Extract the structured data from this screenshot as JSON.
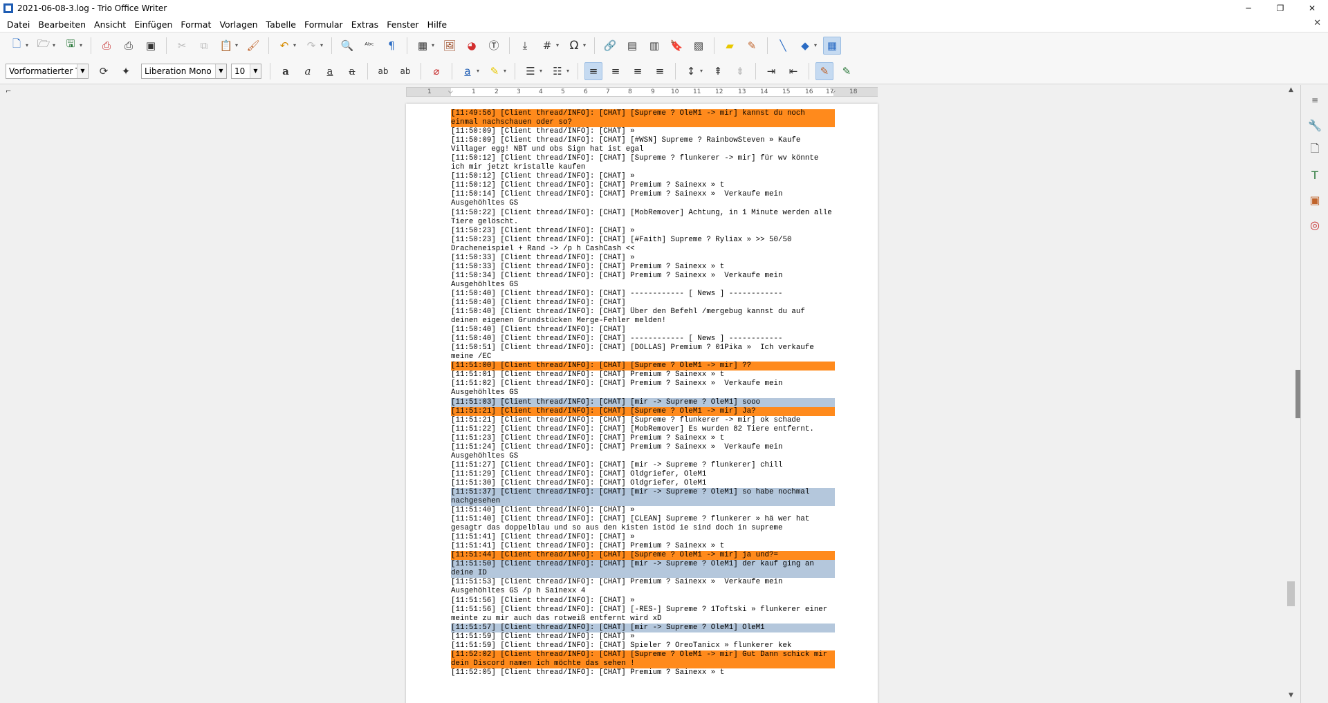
{
  "window": {
    "title": "2021-06-08-3.log - Trio Office Writer",
    "minimize": "─",
    "maximize": "❐",
    "close": "✕"
  },
  "menu": [
    "Datei",
    "Bearbeiten",
    "Ansicht",
    "Einfügen",
    "Format",
    "Vorlagen",
    "Tabelle",
    "Formular",
    "Extras",
    "Fenster",
    "Hilfe"
  ],
  "formatting": {
    "paragraph_style": "Vorformatierter Text",
    "font_name": "Liberation Mono",
    "font_size": "10"
  },
  "ruler": {
    "ticks": [
      "1",
      "1",
      "2",
      "3",
      "4",
      "5",
      "6",
      "7",
      "8",
      "9",
      "10",
      "11",
      "12",
      "13",
      "14",
      "15",
      "16",
      "17",
      "18"
    ]
  },
  "colors": {
    "highlight_orange": "#ff8a1c",
    "highlight_blue": "#b4c7dc"
  },
  "document": {
    "lines": [
      {
        "text": "[11:49:56] [Client thread/INFO]: [CHAT] [Supreme ? OleM1 -> mir] kannst du noch einmal nachschauen oder so?",
        "hl": "orange"
      },
      {
        "text": "[11:50:09] [Client thread/INFO]: [CHAT] »",
        "hl": ""
      },
      {
        "text": "[11:50:09] [Client thread/INFO]: [CHAT] [#WSN] Supreme ? RainbowSteven » Kaufe Villager egg! NBT und obs Sign hat ist egal",
        "hl": ""
      },
      {
        "text": "[11:50:12] [Client thread/INFO]: [CHAT] [Supreme ? flunkerer -> mir] für wv könnte ich mir jetzt kristalle kaufen",
        "hl": ""
      },
      {
        "text": "[11:50:12] [Client thread/INFO]: [CHAT] »",
        "hl": ""
      },
      {
        "text": "[11:50:12] [Client thread/INFO]: [CHAT] Premium ? Sainexx » t",
        "hl": ""
      },
      {
        "text": "[11:50:14] [Client thread/INFO]: [CHAT] Premium ? Sainexx »  Verkaufe mein Ausgehöhltes GS",
        "hl": ""
      },
      {
        "text": "[11:50:22] [Client thread/INFO]: [CHAT] [MobRemover] Achtung, in 1 Minute werden alle Tiere gelöscht.",
        "hl": ""
      },
      {
        "text": "[11:50:23] [Client thread/INFO]: [CHAT] »",
        "hl": ""
      },
      {
        "text": "[11:50:23] [Client thread/INFO]: [CHAT] [#Faith] Supreme ? Ryliax » >> 50/50 Dracheneispiel + Rand -> /p h CashCash <<",
        "hl": ""
      },
      {
        "text": "[11:50:33] [Client thread/INFO]: [CHAT] »",
        "hl": ""
      },
      {
        "text": "[11:50:33] [Client thread/INFO]: [CHAT] Premium ? Sainexx » t",
        "hl": ""
      },
      {
        "text": "[11:50:34] [Client thread/INFO]: [CHAT] Premium ? Sainexx »  Verkaufe mein Ausgehöhltes GS",
        "hl": ""
      },
      {
        "text": "[11:50:40] [Client thread/INFO]: [CHAT] ------------ [ News ] ------------",
        "hl": ""
      },
      {
        "text": "[11:50:40] [Client thread/INFO]: [CHAT]",
        "hl": ""
      },
      {
        "text": "[11:50:40] [Client thread/INFO]: [CHAT] Über den Befehl /mergebug kannst du auf deinen eigenen Grundstücken Merge-Fehler melden!",
        "hl": ""
      },
      {
        "text": "[11:50:40] [Client thread/INFO]: [CHAT]",
        "hl": ""
      },
      {
        "text": "[11:50:40] [Client thread/INFO]: [CHAT] ------------ [ News ] ------------",
        "hl": ""
      },
      {
        "text": "[11:50:51] [Client thread/INFO]: [CHAT] [DOLLAS] Premium ? 01Pika »  Ich verkaufe meine /EC",
        "hl": ""
      },
      {
        "text": "[11:51:00] [Client thread/INFO]: [CHAT] [Supreme ? OleM1 -> mir] ??",
        "hl": "orange"
      },
      {
        "text": "[11:51:01] [Client thread/INFO]: [CHAT] Premium ? Sainexx » t",
        "hl": ""
      },
      {
        "text": "[11:51:02] [Client thread/INFO]: [CHAT] Premium ? Sainexx »  Verkaufe mein Ausgehöhltes GS",
        "hl": ""
      },
      {
        "text": "[11:51:03] [Client thread/INFO]: [CHAT] [mir -> Supreme ? OleM1] sooo",
        "hl": "blue"
      },
      {
        "text": "[11:51:21] [Client thread/INFO]: [CHAT] [Supreme ? OleM1 -> mir] Ja?",
        "hl": "orange"
      },
      {
        "text": "[11:51:21] [Client thread/INFO]: [CHAT] [Supreme ? flunkerer -> mir] ok schade",
        "hl": ""
      },
      {
        "text": "[11:51:22] [Client thread/INFO]: [CHAT] [MobRemover] Es wurden 82 Tiere entfernt.",
        "hl": ""
      },
      {
        "text": "[11:51:23] [Client thread/INFO]: [CHAT] Premium ? Sainexx » t",
        "hl": ""
      },
      {
        "text": "[11:51:24] [Client thread/INFO]: [CHAT] Premium ? Sainexx »  Verkaufe mein Ausgehöhltes GS",
        "hl": ""
      },
      {
        "text": "[11:51:27] [Client thread/INFO]: [CHAT] [mir -> Supreme ? flunkerer] chill",
        "hl": ""
      },
      {
        "text": "[11:51:29] [Client thread/INFO]: [CHAT] Oldgriefer, OleM1",
        "hl": ""
      },
      {
        "text": "[11:51:30] [Client thread/INFO]: [CHAT] Oldgriefer, OleM1",
        "hl": ""
      },
      {
        "text": "[11:51:37] [Client thread/INFO]: [CHAT] [mir -> Supreme ? OleM1] so habe nochmal nachgesehen",
        "hl": "blue"
      },
      {
        "text": "[11:51:40] [Client thread/INFO]: [CHAT] »",
        "hl": ""
      },
      {
        "text": "[11:51:40] [Client thread/INFO]: [CHAT] [CLEAN] Supreme ? flunkerer » hä wer hat gesagtr das doppelblau und so aus den kisten istöd ie sind doch in supreme",
        "hl": ""
      },
      {
        "text": "[11:51:41] [Client thread/INFO]: [CHAT] »",
        "hl": ""
      },
      {
        "text": "[11:51:41] [Client thread/INFO]: [CHAT] Premium ? Sainexx » t",
        "hl": ""
      },
      {
        "text": "[11:51:44] [Client thread/INFO]: [CHAT] [Supreme ? OleM1 -> mir] ja und?=",
        "hl": "orange"
      },
      {
        "text": "[11:51:50] [Client thread/INFO]: [CHAT] [mir -> Supreme ? OleM1] der kauf ging an deine ID",
        "hl": "blue"
      },
      {
        "text": "[11:51:53] [Client thread/INFO]: [CHAT] Premium ? Sainexx »  Verkaufe mein Ausgehöhltes GS /p h Sainexx 4",
        "hl": ""
      },
      {
        "text": "[11:51:56] [Client thread/INFO]: [CHAT] »",
        "hl": ""
      },
      {
        "text": "[11:51:56] [Client thread/INFO]: [CHAT] [-RES-] Supreme ? 1Toftski » flunkerer einer meinte zu mir auch das rotweiß entfernt wird xD",
        "hl": ""
      },
      {
        "text": "[11:51:57] [Client thread/INFO]: [CHAT] [mir -> Supreme ? OleM1] OleM1",
        "hl": "blue"
      },
      {
        "text": "[11:51:59] [Client thread/INFO]: [CHAT] »",
        "hl": ""
      },
      {
        "text": "[11:51:59] [Client thread/INFO]: [CHAT] Spieler ? OreoTanicx » flunkerer kek",
        "hl": ""
      },
      {
        "text": "[11:52:02] [Client thread/INFO]: [CHAT] [Supreme ? OleM1 -> mir] Gut Dann schick mir dein Discord namen ich möchte das sehen !",
        "hl": "orange"
      },
      {
        "text": "[11:52:05] [Client thread/INFO]: [CHAT] Premium ? Sainexx » t",
        "hl": ""
      }
    ]
  }
}
